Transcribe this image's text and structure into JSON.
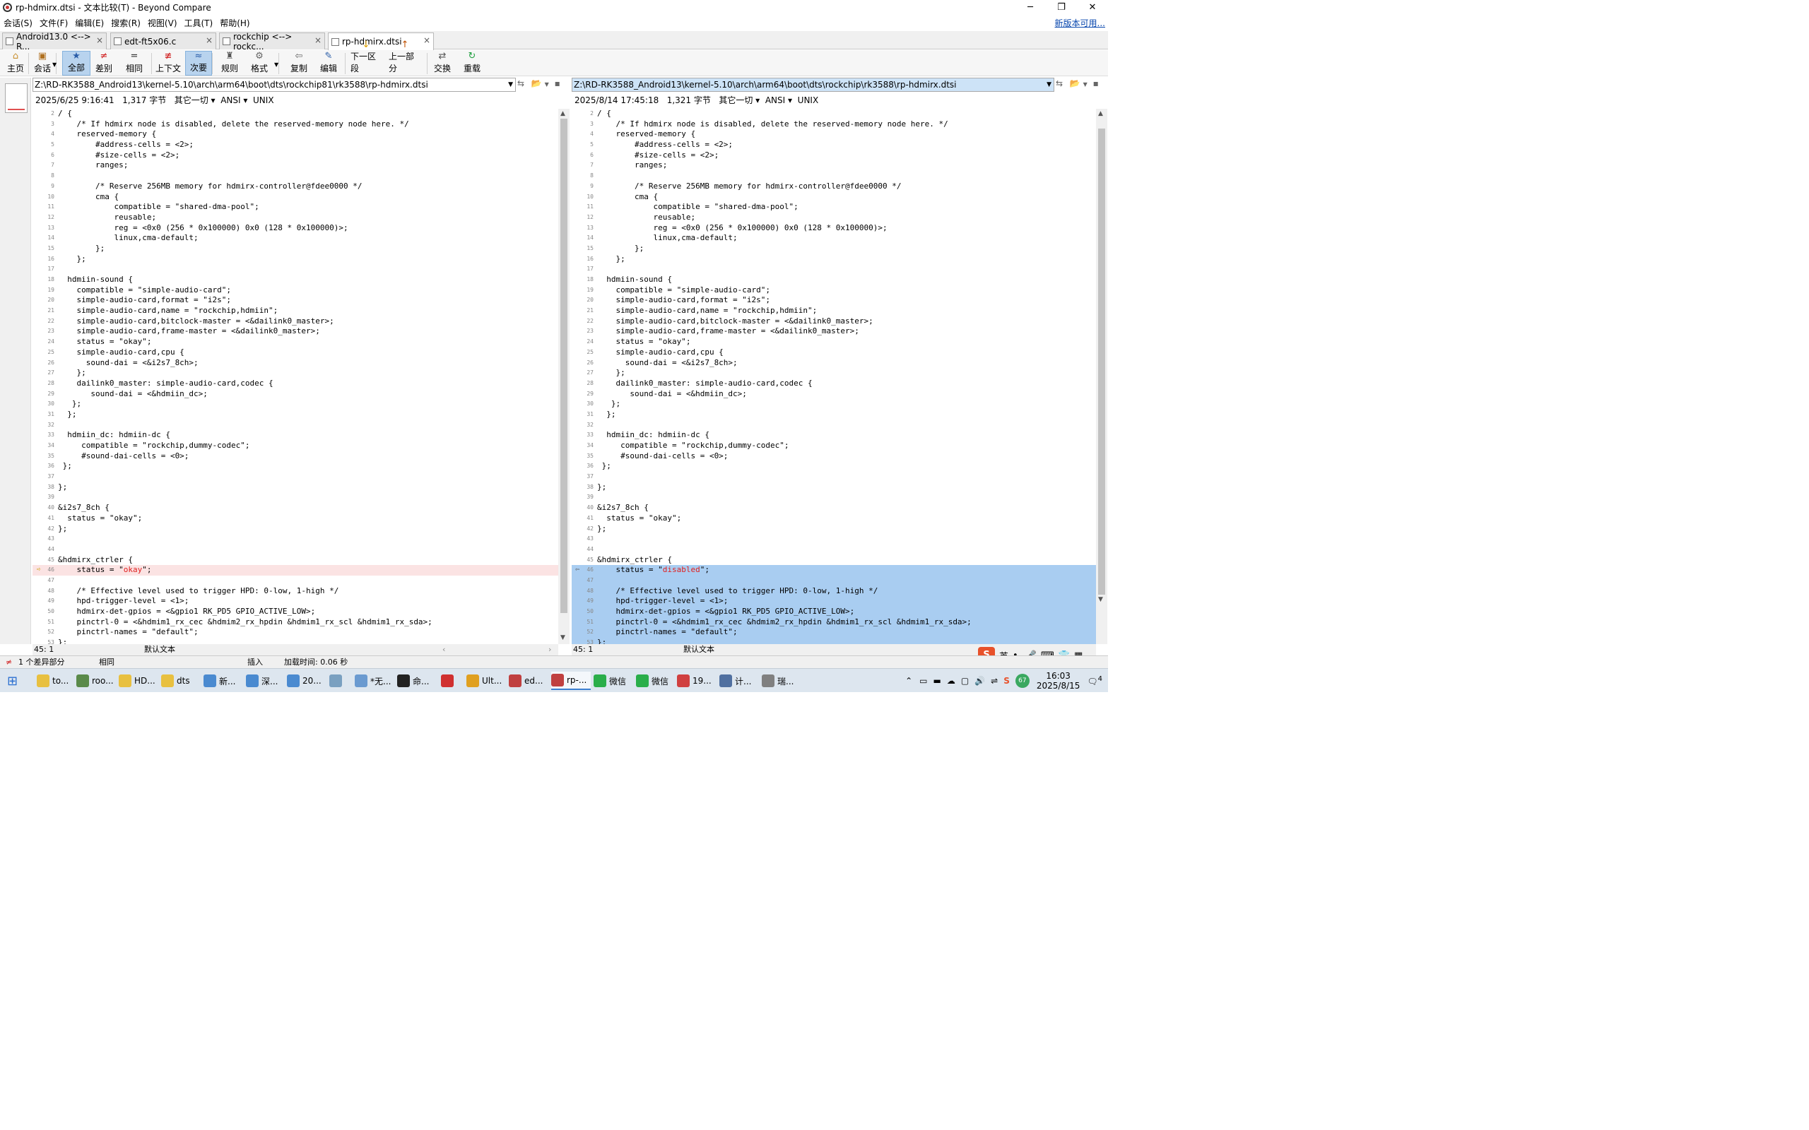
{
  "window": {
    "title": "rp-hdmirx.dtsi - 文本比较(T) - Beyond Compare",
    "controls": [
      "─",
      "❐",
      "✕"
    ]
  },
  "menu": {
    "items": [
      "会话(S)",
      "文件(F)",
      "编辑(E)",
      "搜索(R)",
      "视图(V)",
      "工具(T)",
      "帮助(H)"
    ],
    "update_link": "新版本可用..."
  },
  "tabs": [
    {
      "label": "Android13.0 <--> R...",
      "active": false
    },
    {
      "label": "edt-ft5x06.c",
      "active": false
    },
    {
      "label": "rockchip <--> rockc...",
      "active": false
    },
    {
      "label": "rp-hdmirx.dtsi",
      "active": true
    }
  ],
  "toolbar": [
    {
      "label": "主页",
      "icon": "home-icon",
      "glyph": "⌂",
      "color": "#c89030"
    },
    {
      "label": "会话",
      "icon": "session-icon",
      "glyph": "▣",
      "color": "#b07020"
    },
    {
      "label": "全部",
      "icon": "all-icon",
      "glyph": "★",
      "color": "#2a5da8",
      "active": true
    },
    {
      "label": "差别",
      "icon": "diff-icon",
      "glyph": "≠",
      "color": "#d02020"
    },
    {
      "label": "相同",
      "icon": "same-icon",
      "glyph": "=",
      "color": "#333333"
    },
    {
      "label": "上下文",
      "icon": "context-icon",
      "glyph": "≢",
      "color": "#d02020"
    },
    {
      "label": "次要",
      "icon": "minor-icon",
      "glyph": "≈",
      "color": "#2a5da8",
      "active": true
    },
    {
      "label": "规则",
      "icon": "rules-icon",
      "glyph": "♜",
      "color": "#555555"
    },
    {
      "label": "格式",
      "icon": "format-icon",
      "glyph": "⚙",
      "color": "#666666"
    },
    {
      "label": "复制",
      "icon": "copy-icon",
      "glyph": "⇦",
      "color": "#666666"
    },
    {
      "label": "编辑",
      "icon": "edit-icon",
      "glyph": "✎",
      "color": "#2a5da8"
    },
    {
      "label": "下一区段",
      "icon": "next-section-icon",
      "glyph": "↓",
      "color": "#e0a000"
    },
    {
      "label": "上一部分",
      "icon": "prev-section-icon",
      "glyph": "↑",
      "color": "#c05000"
    },
    {
      "label": "交换",
      "icon": "swap-icon",
      "glyph": "⇄",
      "color": "#555555"
    },
    {
      "label": "重载",
      "icon": "reload-icon",
      "glyph": "↻",
      "color": "#20a040"
    }
  ],
  "left": {
    "path": "Z:\\RD-RK3588_Android13\\kernel-5.10\\arch\\arm64\\boot\\dts\\rockchip81\\rk3588\\rp-hdmirx.dtsi",
    "info": {
      "date": "2025/6/25 9:16:41",
      "size": "1,317 字节",
      "other": "其它一切",
      "encoding": "ANSI",
      "eol": "UNIX"
    },
    "cursor": "45: 1",
    "format": "默认文本"
  },
  "right": {
    "path": "Z:\\RD-RK3588_Android13\\kernel-5.10\\arch\\arm64\\boot\\dts\\rockchip\\rk3588\\rp-hdmirx.dtsi",
    "info": {
      "date": "2025/8/14 17:45:18",
      "size": "1,321 字节",
      "other": "其它一切",
      "encoding": "ANSI",
      "eol": "UNIX"
    },
    "cursor": "45: 1",
    "format": "默认文本"
  },
  "lines": [
    {
      "n": "2",
      "t": "/ {"
    },
    {
      "n": "3",
      "t": "    /* If hdmirx node is disabled, delete the reserved-memory node here. */"
    },
    {
      "n": "4",
      "t": "    reserved-memory {"
    },
    {
      "n": "5",
      "t": "        #address-cells = <2>;"
    },
    {
      "n": "6",
      "t": "        #size-cells = <2>;"
    },
    {
      "n": "7",
      "t": "        ranges;"
    },
    {
      "n": "8",
      "t": ""
    },
    {
      "n": "9",
      "t": "        /* Reserve 256MB memory for hdmirx-controller@fdee0000 */"
    },
    {
      "n": "10",
      "t": "        cma {"
    },
    {
      "n": "11",
      "t": "            compatible = \"shared-dma-pool\";"
    },
    {
      "n": "12",
      "t": "            reusable;"
    },
    {
      "n": "13",
      "t": "            reg = <0x0 (256 * 0x100000) 0x0 (128 * 0x100000)>;"
    },
    {
      "n": "14",
      "t": "            linux,cma-default;"
    },
    {
      "n": "15",
      "t": "        };"
    },
    {
      "n": "16",
      "t": "    };"
    },
    {
      "n": "17",
      "t": ""
    },
    {
      "n": "18",
      "t": "  hdmiin-sound {"
    },
    {
      "n": "19",
      "t": "    compatible = \"simple-audio-card\";"
    },
    {
      "n": "20",
      "t": "    simple-audio-card,format = \"i2s\";"
    },
    {
      "n": "21",
      "t": "    simple-audio-card,name = \"rockchip,hdmiin\";"
    },
    {
      "n": "22",
      "t": "    simple-audio-card,bitclock-master = <&dailink0_master>;"
    },
    {
      "n": "23",
      "t": "    simple-audio-card,frame-master = <&dailink0_master>;"
    },
    {
      "n": "24",
      "t": "    status = \"okay\";"
    },
    {
      "n": "25",
      "t": "    simple-audio-card,cpu {"
    },
    {
      "n": "26",
      "t": "      sound-dai = <&i2s7_8ch>;"
    },
    {
      "n": "27",
      "t": "    };"
    },
    {
      "n": "28",
      "t": "    dailink0_master: simple-audio-card,codec {"
    },
    {
      "n": "29",
      "t": "       sound-dai = <&hdmiin_dc>;"
    },
    {
      "n": "30",
      "t": "   };"
    },
    {
      "n": "31",
      "t": "  };"
    },
    {
      "n": "32",
      "t": ""
    },
    {
      "n": "33",
      "t": "  hdmiin_dc: hdmiin-dc {"
    },
    {
      "n": "34",
      "t": "     compatible = \"rockchip,dummy-codec\";"
    },
    {
      "n": "35",
      "t": "     #sound-dai-cells = <0>;"
    },
    {
      "n": "36",
      "t": " };"
    },
    {
      "n": "37",
      "t": ""
    },
    {
      "n": "38",
      "t": "};"
    },
    {
      "n": "39",
      "t": ""
    },
    {
      "n": "40",
      "t": "&i2s7_8ch {"
    },
    {
      "n": "41",
      "t": "  status = \"okay\";"
    },
    {
      "n": "42",
      "t": "};"
    },
    {
      "n": "43",
      "t": ""
    },
    {
      "n": "44",
      "t": ""
    },
    {
      "n": "45",
      "t": "&hdmirx_ctrler {"
    },
    {
      "n": "46",
      "t": "    status = \"okay\";",
      "rt": "    status = \"disabled\";",
      "diff": true
    },
    {
      "n": "47",
      "t": ""
    },
    {
      "n": "48",
      "t": "    /* Effective level used to trigger HPD: 0-low, 1-high */"
    },
    {
      "n": "49",
      "t": "    hpd-trigger-level = <1>;"
    },
    {
      "n": "50",
      "t": "    hdmirx-det-gpios = <&gpio1 RK_PD5 GPIO_ACTIVE_LOW>;"
    },
    {
      "n": "51",
      "t": "    pinctrl-0 = <&hdmim1_rx_cec &hdmim2_rx_hpdin &hdmim1_rx_scl &hdmim1_rx_sda>;"
    },
    {
      "n": "52",
      "t": "    pinctrl-names = \"default\";"
    },
    {
      "n": "53",
      "t": "};"
    }
  ],
  "diff_line_index": 44,
  "status": {
    "diff_count": "1 个差异部分",
    "same": "相同",
    "insert": "插入",
    "load_time": "加载时间: 0.06 秒"
  },
  "ime": {
    "lang": "英",
    "badge": "S"
  },
  "taskbar": {
    "items": [
      {
        "label": "to...",
        "color": "#e8c040"
      },
      {
        "label": "roo...",
        "color": "#5a8a4a"
      },
      {
        "label": "HD...",
        "color": "#e8c040"
      },
      {
        "label": "dts",
        "color": "#e8c040"
      },
      {
        "label": "新...",
        "color": "#4a8ad0"
      },
      {
        "label": "深...",
        "color": "#4a8ad0"
      },
      {
        "label": "20...",
        "color": "#4a8ad0"
      },
      {
        "label": "",
        "color": "#7aa0c0"
      },
      {
        "label": "*无...",
        "color": "#6a9ad0"
      },
      {
        "label": "命...",
        "color": "#222222"
      },
      {
        "label": "",
        "color": "#d03030"
      },
      {
        "label": "Ult...",
        "color": "#e0a020"
      },
      {
        "label": "ed...",
        "color": "#c04040"
      },
      {
        "label": "rp-...",
        "color": "#c04040",
        "active": true
      },
      {
        "label": "微信",
        "color": "#2aae4a"
      },
      {
        "label": "微信",
        "color": "#2aae4a"
      },
      {
        "label": "19...",
        "color": "#d04040"
      },
      {
        "label": "计...",
        "color": "#5070a0"
      },
      {
        "label": "瑞...",
        "color": "#808080"
      }
    ],
    "time": "16:03",
    "date": "2025/8/15",
    "notif": "4",
    "battery": "67"
  }
}
